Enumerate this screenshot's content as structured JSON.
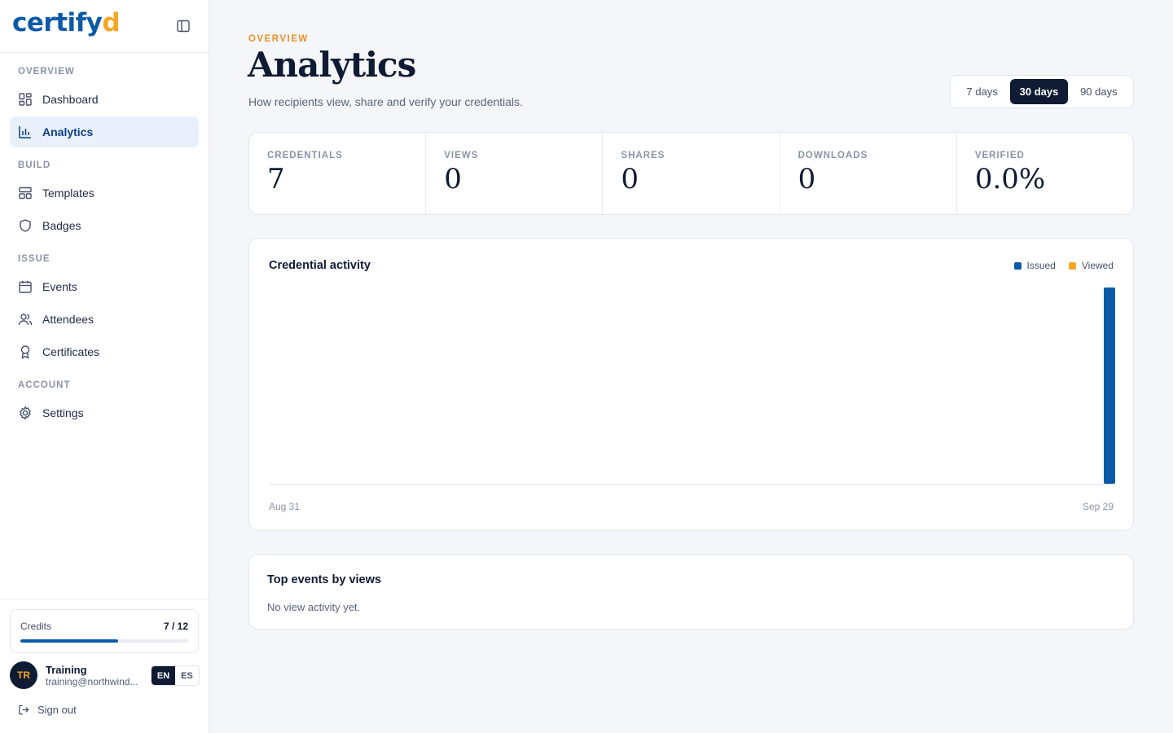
{
  "brand": {
    "name_main": "certify",
    "name_accent": "d",
    "brand_color": "#0b5aa8",
    "accent_color": "#f5a623"
  },
  "sidebar": {
    "sections": [
      {
        "label": "OVERVIEW",
        "items": [
          {
            "label": "Dashboard",
            "icon": "dashboard-icon"
          },
          {
            "label": "Analytics",
            "icon": "bar-chart-icon",
            "active": true
          }
        ]
      },
      {
        "label": "BUILD",
        "items": [
          {
            "label": "Templates",
            "icon": "template-icon"
          },
          {
            "label": "Badges",
            "icon": "shield-icon"
          }
        ]
      },
      {
        "label": "ISSUE",
        "items": [
          {
            "label": "Events",
            "icon": "calendar-icon"
          },
          {
            "label": "Attendees",
            "icon": "users-icon"
          },
          {
            "label": "Certificates",
            "icon": "award-icon"
          }
        ]
      },
      {
        "label": "ACCOUNT",
        "items": [
          {
            "label": "Settings",
            "icon": "gear-icon"
          }
        ]
      }
    ],
    "credits": {
      "label": "Credits",
      "value": "7 / 12",
      "used": 7,
      "total": 12
    },
    "user": {
      "initials": "TR",
      "name": "Training",
      "email": "training@northwind..."
    },
    "languages": [
      {
        "code": "EN",
        "active": true
      },
      {
        "code": "ES",
        "active": false
      }
    ],
    "signout_label": "Sign out"
  },
  "header": {
    "eyebrow": "OVERVIEW",
    "title": "Analytics",
    "subtitle": "How recipients view, share and verify your credentials.",
    "ranges": [
      {
        "label": "7 days",
        "active": false
      },
      {
        "label": "30 days",
        "active": true
      },
      {
        "label": "90 days",
        "active": false
      }
    ]
  },
  "stats": [
    {
      "label": "CREDENTIALS",
      "value": "7"
    },
    {
      "label": "VIEWS",
      "value": "0"
    },
    {
      "label": "SHARES",
      "value": "0"
    },
    {
      "label": "DOWNLOADS",
      "value": "0"
    },
    {
      "label": "VERIFIED",
      "value": "0.0%"
    }
  ],
  "chart_card": {
    "title": "Credential activity"
  },
  "chart_data": {
    "type": "bar",
    "x_first_label": "Aug 31",
    "x_last_label": "Sep 29",
    "num_days": 30,
    "series": [
      {
        "name": "Issued",
        "color": "#0b5aa8",
        "values": [
          0,
          0,
          0,
          0,
          0,
          0,
          0,
          0,
          0,
          0,
          0,
          0,
          0,
          0,
          0,
          0,
          0,
          0,
          0,
          0,
          0,
          0,
          0,
          0,
          0,
          0,
          0,
          0,
          0,
          7
        ]
      },
      {
        "name": "Viewed",
        "color": "#f5a623",
        "values": [
          0,
          0,
          0,
          0,
          0,
          0,
          0,
          0,
          0,
          0,
          0,
          0,
          0,
          0,
          0,
          0,
          0,
          0,
          0,
          0,
          0,
          0,
          0,
          0,
          0,
          0,
          0,
          0,
          0,
          0
        ]
      }
    ],
    "ylim": [
      0,
      7
    ],
    "grid": false,
    "legend": "top-right"
  },
  "top_events": {
    "title": "Top events by views",
    "empty_text": "No view activity yet."
  }
}
